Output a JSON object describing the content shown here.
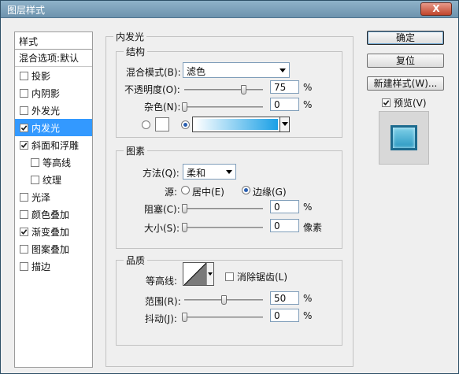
{
  "window": {
    "title": "图层样式",
    "close_label": "X"
  },
  "sidebar": {
    "header": "样式",
    "blend_options": "混合选项:默认",
    "items": [
      {
        "label": "投影",
        "checked": false
      },
      {
        "label": "内阴影",
        "checked": false
      },
      {
        "label": "外发光",
        "checked": false
      },
      {
        "label": "内发光",
        "checked": true,
        "selected": true
      },
      {
        "label": "斜面和浮雕",
        "checked": true
      },
      {
        "label": "等高线",
        "checked": false,
        "sub": true
      },
      {
        "label": "纹理",
        "checked": false,
        "sub": true
      },
      {
        "label": "光泽",
        "checked": false
      },
      {
        "label": "颜色叠加",
        "checked": false
      },
      {
        "label": "渐变叠加",
        "checked": true
      },
      {
        "label": "图案叠加",
        "checked": false
      },
      {
        "label": "描边",
        "checked": false
      }
    ]
  },
  "buttons": {
    "ok": "确定",
    "reset": "复位",
    "new_style": "新建样式(W)...",
    "preview_label": "预览(V)",
    "preview_checked": true
  },
  "inner_glow": {
    "title": "内发光",
    "structure": {
      "title": "结构",
      "blend_mode_label": "混合模式(B):",
      "blend_mode_value": "滤色",
      "opacity_label": "不透明度(O):",
      "opacity_value": "75",
      "opacity_unit": "%",
      "noise_label": "杂色(N):",
      "noise_value": "0",
      "noise_unit": "%",
      "use_gradient": true
    },
    "elements": {
      "title": "图素",
      "method_label": "方法(Q):",
      "method_value": "柔和",
      "source_label": "源:",
      "source_center": "居中(E)",
      "source_edge": "边缘(G)",
      "source_selected": "edge",
      "choke_label": "阻塞(C):",
      "choke_value": "0",
      "choke_unit": "%",
      "size_label": "大小(S):",
      "size_value": "0",
      "size_unit": "像素"
    },
    "quality": {
      "title": "品质",
      "contour_label": "等高线:",
      "antialias_label": "消除锯齿(L)",
      "antialias_checked": false,
      "range_label": "范围(R):",
      "range_value": "50",
      "range_unit": "%",
      "jitter_label": "抖动(J):",
      "jitter_value": "0",
      "jitter_unit": "%"
    }
  },
  "colors": {
    "selection": "#3399ff",
    "gradient_start": "#ffffff",
    "gradient_end": "#1aa0e6"
  }
}
